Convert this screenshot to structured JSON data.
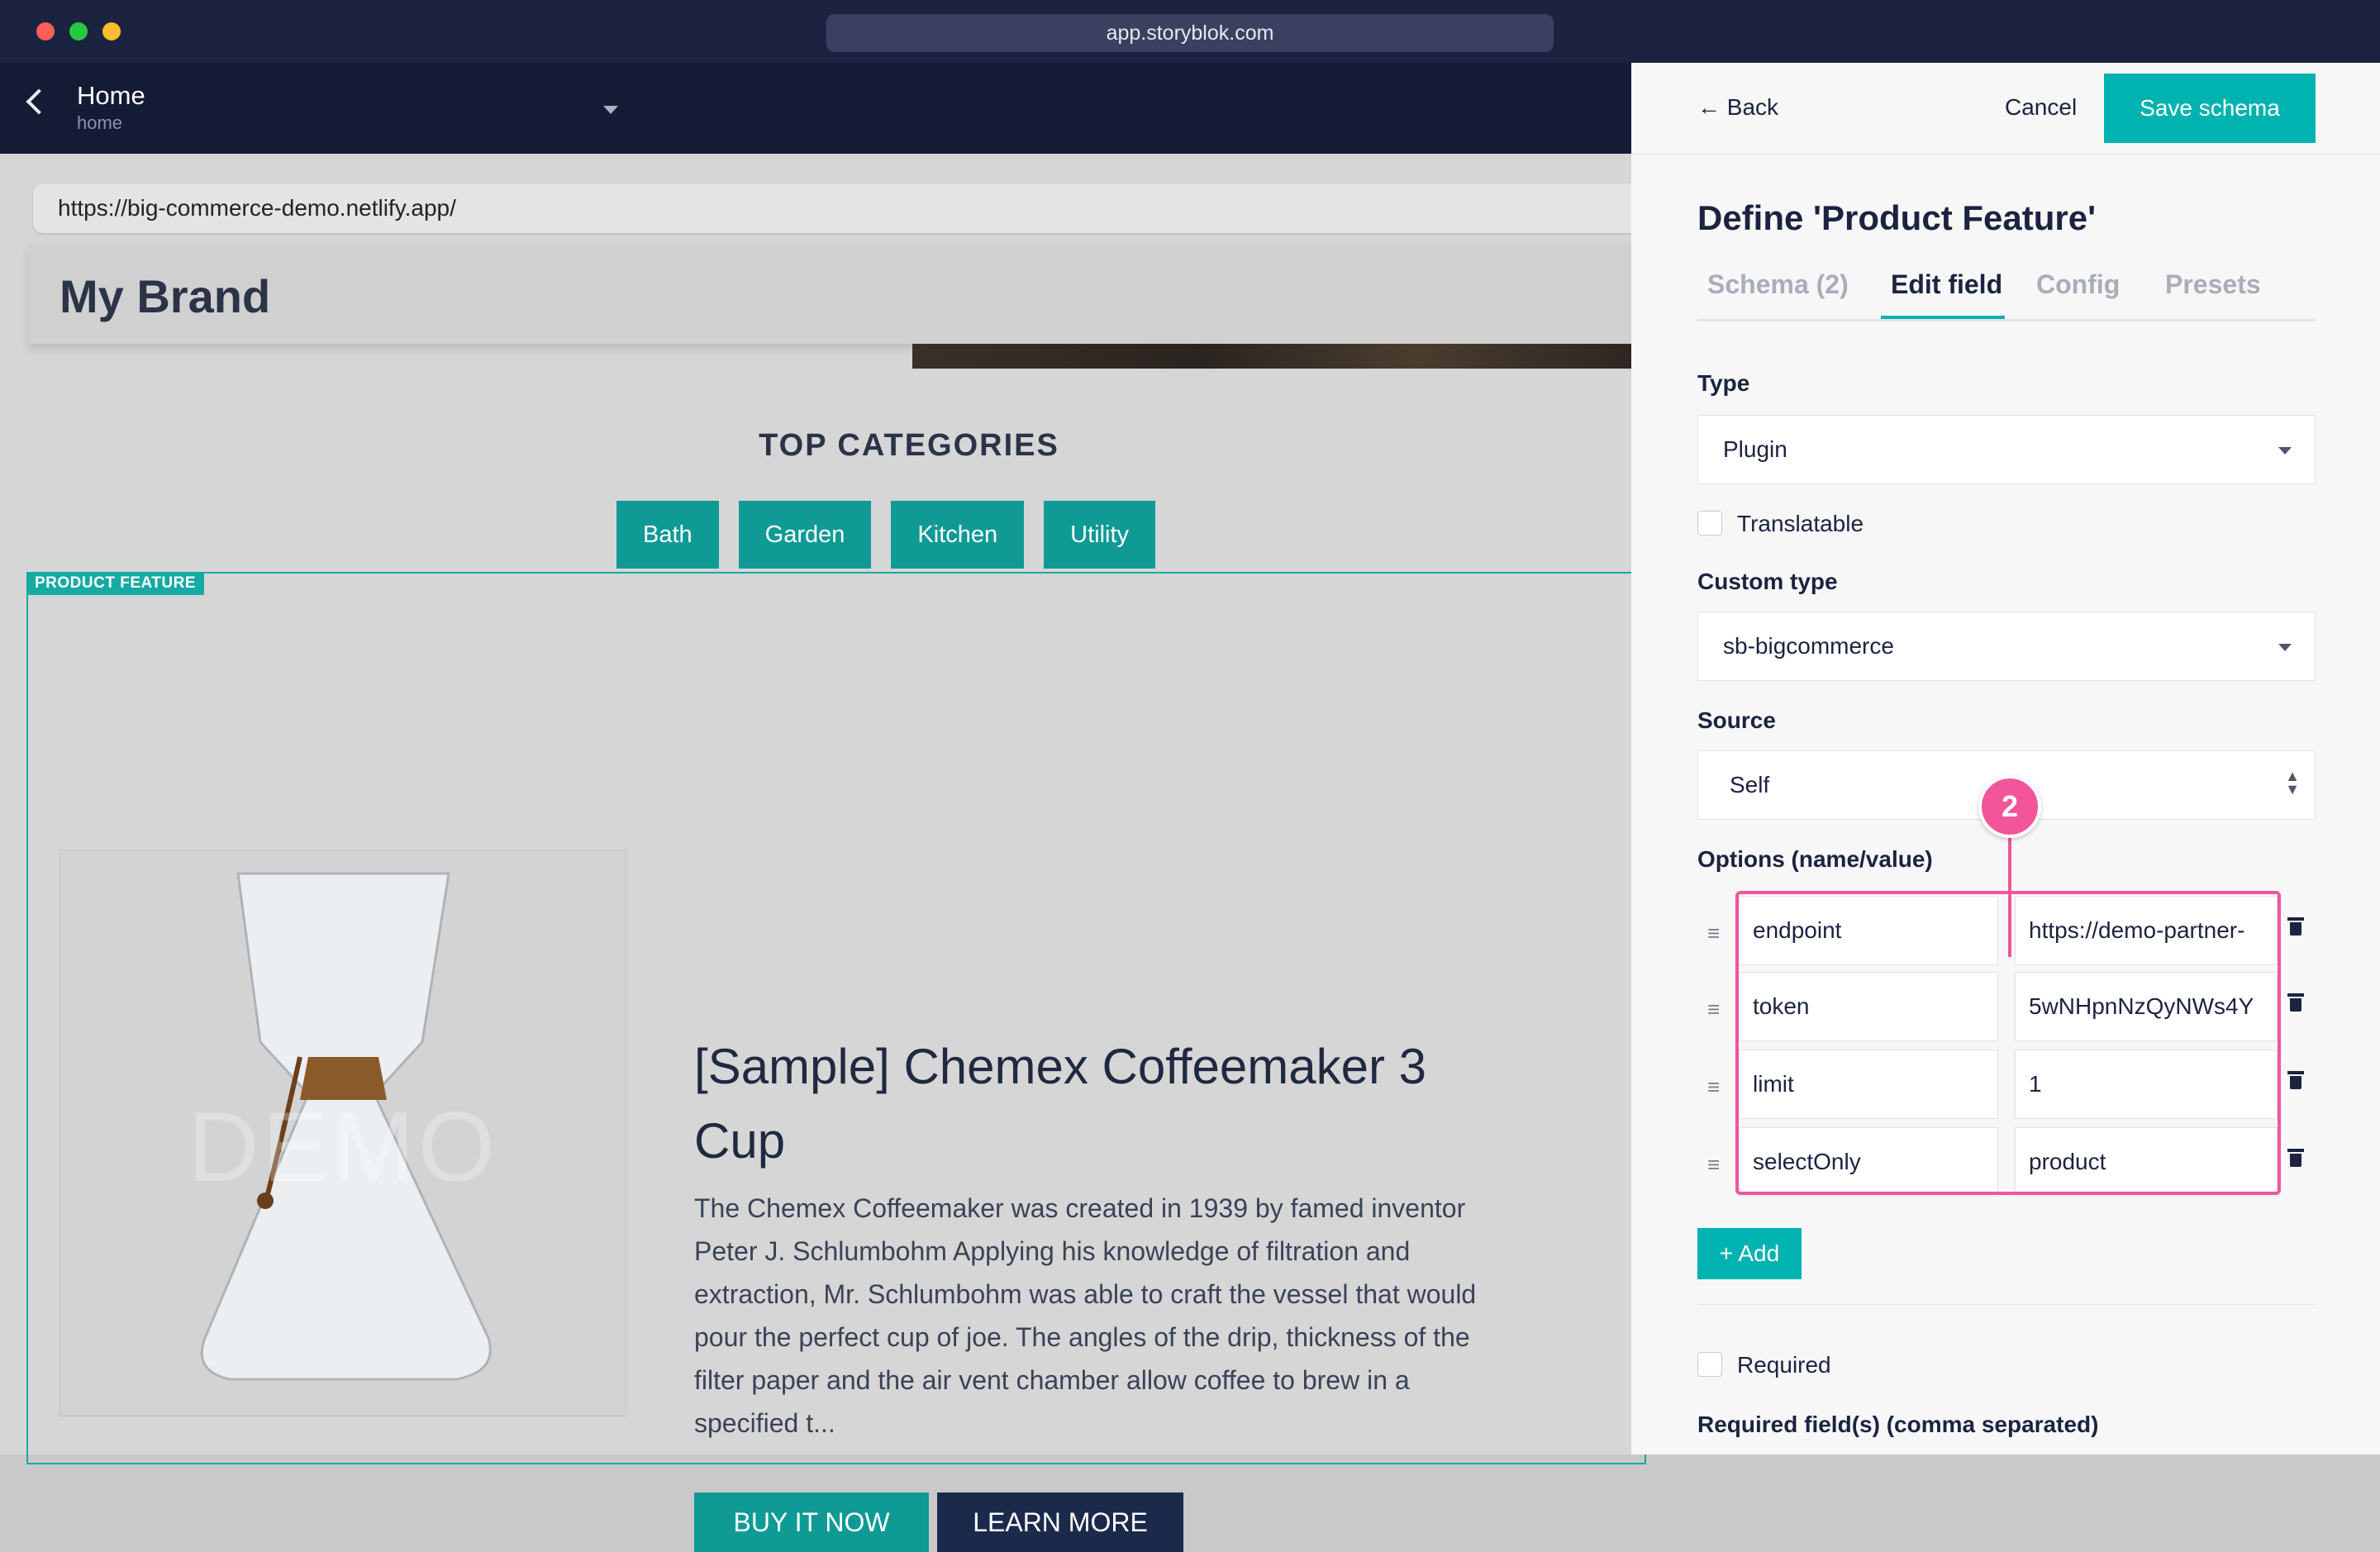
{
  "window": {
    "url": "app.storyblok.com"
  },
  "header": {
    "title": "Home",
    "slug": "home"
  },
  "preview": {
    "url": "https://big-commerce-demo.netlify.app/",
    "brand": "My Brand",
    "categories_heading": "TOP CATEGORIES",
    "categories": [
      "Bath",
      "Garden",
      "Kitchen",
      "Utility"
    ],
    "block_tag": "PRODUCT FEATURE",
    "watermark": "DEMO",
    "product_title": "[Sample] Chemex Coffeemaker 3 Cup",
    "product_description": "The Chemex Coffeemaker was created in 1939 by famed inventor Peter J. Schlumbohm Applying his knowledge of filtration and extraction, Mr. Schlumbohm was able to craft the vessel that would pour the perfect cup of joe. The angles of the drip, thickness of the filter paper and the air vent chamber allow coffee to brew in a specified t...",
    "buy_label": "BUY IT NOW",
    "learn_label": "LEARN MORE"
  },
  "panel": {
    "back_label": "← Back",
    "cancel_label": "Cancel",
    "save_label": "Save schema",
    "title": "Define 'Product Feature'",
    "tabs": [
      "Schema (2)",
      "Edit field",
      "Config",
      "Presets"
    ],
    "active_tab": "Edit field",
    "type_label": "Type",
    "type_value": "Plugin",
    "translatable_label": "Translatable",
    "custom_type_label": "Custom type",
    "custom_type_value": "sb-bigcommerce",
    "source_label": "Source",
    "source_value": "Self",
    "step_marker": "2",
    "options_label": "Options (name/value)",
    "options": [
      {
        "name": "endpoint",
        "value": "https://demo-partner-"
      },
      {
        "name": "token",
        "value": "5wNHpnNzQyNWs4Y"
      },
      {
        "name": "limit",
        "value": "1"
      },
      {
        "name": "selectOnly",
        "value": "product"
      }
    ],
    "add_label": "+ Add",
    "required_label": "Required",
    "required_fields_label": "Required field(s) (comma separated)"
  },
  "colors": {
    "accent": "#00b3b0",
    "highlight": "#f2559a",
    "navy": "#1b2340"
  }
}
